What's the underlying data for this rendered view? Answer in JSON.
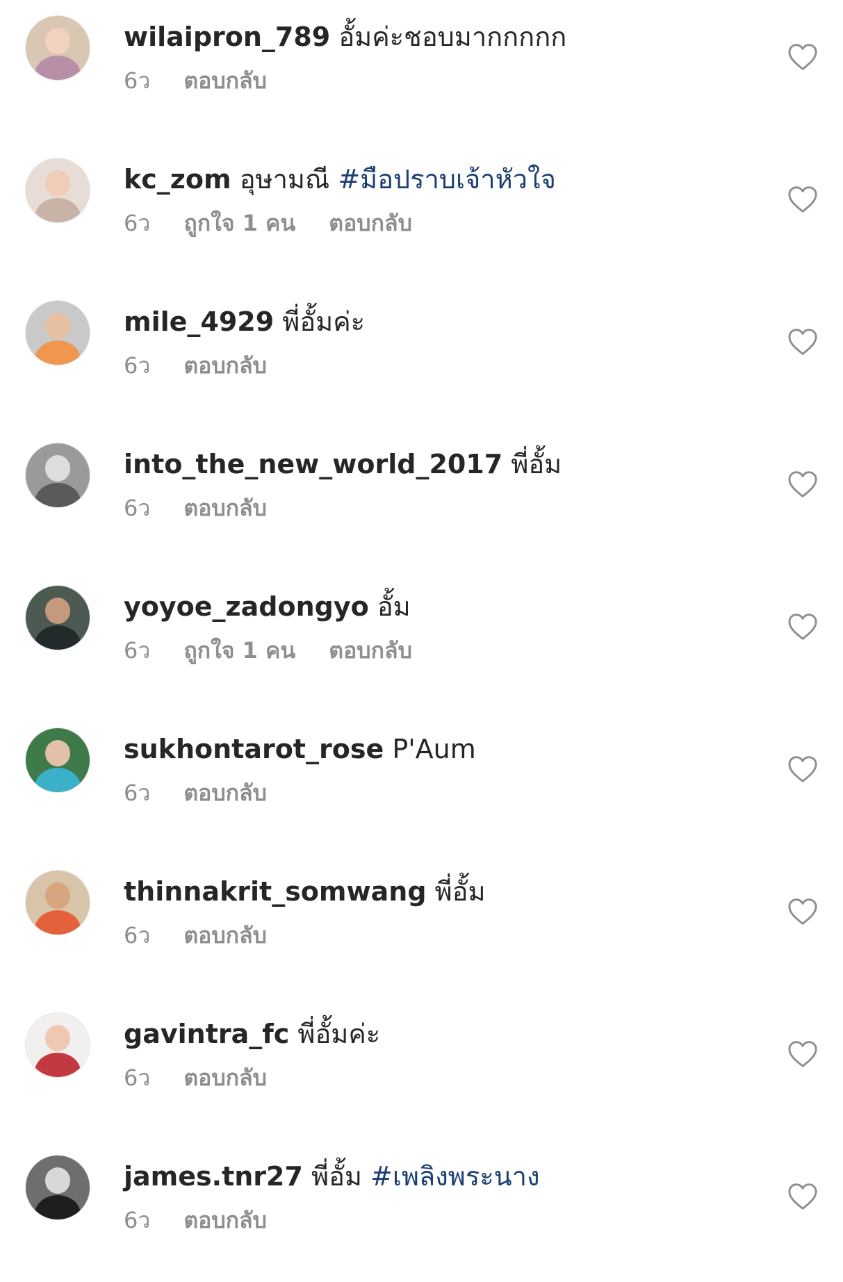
{
  "comments": [
    {
      "username": "wilaipron_789",
      "text": "อั้มค่ะชอบมากกกกก",
      "hashtag": "",
      "time": "6ว",
      "likes": "",
      "reply": "ตอบกลับ",
      "avatar_colors": {
        "bg": "#d9c6b3",
        "face": "#f1d2bf",
        "body": "#b98fa8"
      }
    },
    {
      "username": "kc_zom",
      "text": "อุษามณี",
      "hashtag": "#มือปราบเจ้าหัวใจ",
      "time": "6ว",
      "likes": "ถูกใจ 1 คน",
      "reply": "ตอบกลับ",
      "avatar_colors": {
        "bg": "#e8ddd6",
        "face": "#f0cdb8",
        "body": "#c9b3a6"
      }
    },
    {
      "username": "mile_4929",
      "text": "พี่อั้มค่ะ",
      "hashtag": "",
      "time": "6ว",
      "likes": "",
      "reply": "ตอบกลับ",
      "avatar_colors": {
        "bg": "#c9c9c9",
        "face": "#e6c0a0",
        "body": "#f0964f"
      }
    },
    {
      "username": "into_the_new_world_2017",
      "text": "พี่อั้ม",
      "hashtag": "",
      "time": "6ว",
      "likes": "",
      "reply": "ตอบกลับ",
      "avatar_colors": {
        "bg": "#9a9a9a",
        "face": "#dedede",
        "body": "#5a5a5a"
      }
    },
    {
      "username": "yoyoe_zadongyo",
      "text": "อั้ม",
      "hashtag": "",
      "time": "6ว",
      "likes": "ถูกใจ 1 คน",
      "reply": "ตอบกลับ",
      "avatar_colors": {
        "bg": "#4d5a52",
        "face": "#c49a7c",
        "body": "#222a2c"
      }
    },
    {
      "username": "sukhontarot_rose",
      "text": "P'Aum",
      "hashtag": "",
      "time": "6ว",
      "likes": "",
      "reply": "ตอบกลับ",
      "avatar_colors": {
        "bg": "#3f7a4a",
        "face": "#e2c1a8",
        "body": "#3bb0c9"
      }
    },
    {
      "username": "thinnakrit_somwang",
      "text": "พี่อั้ม",
      "hashtag": "",
      "time": "6ว",
      "likes": "",
      "reply": "ตอบกลับ",
      "avatar_colors": {
        "bg": "#d7c4a9",
        "face": "#d6a67e",
        "body": "#e3623c"
      }
    },
    {
      "username": "gavintra_fc",
      "text": "พี่อั้มค่ะ",
      "hashtag": "",
      "time": "6ว",
      "likes": "",
      "reply": "ตอบกลับ",
      "avatar_colors": {
        "bg": "#f2f0ee",
        "face": "#efc8b3",
        "body": "#c23a3f"
      }
    },
    {
      "username": "james.tnr27",
      "text": "พี่อั้ม",
      "hashtag": "#เพลิงพระนาง",
      "time": "6ว",
      "likes": "",
      "reply": "ตอบกลับ",
      "avatar_colors": {
        "bg": "#6e6e6e",
        "face": "#d8d8d8",
        "body": "#1e1e1e"
      }
    }
  ],
  "colors": {
    "username": "#262626",
    "hashtag": "#1c3f73",
    "meta": "#8e8e8e",
    "heart_stroke": "#8e8e8e"
  },
  "icons": {
    "like": "heart-outline-icon"
  }
}
